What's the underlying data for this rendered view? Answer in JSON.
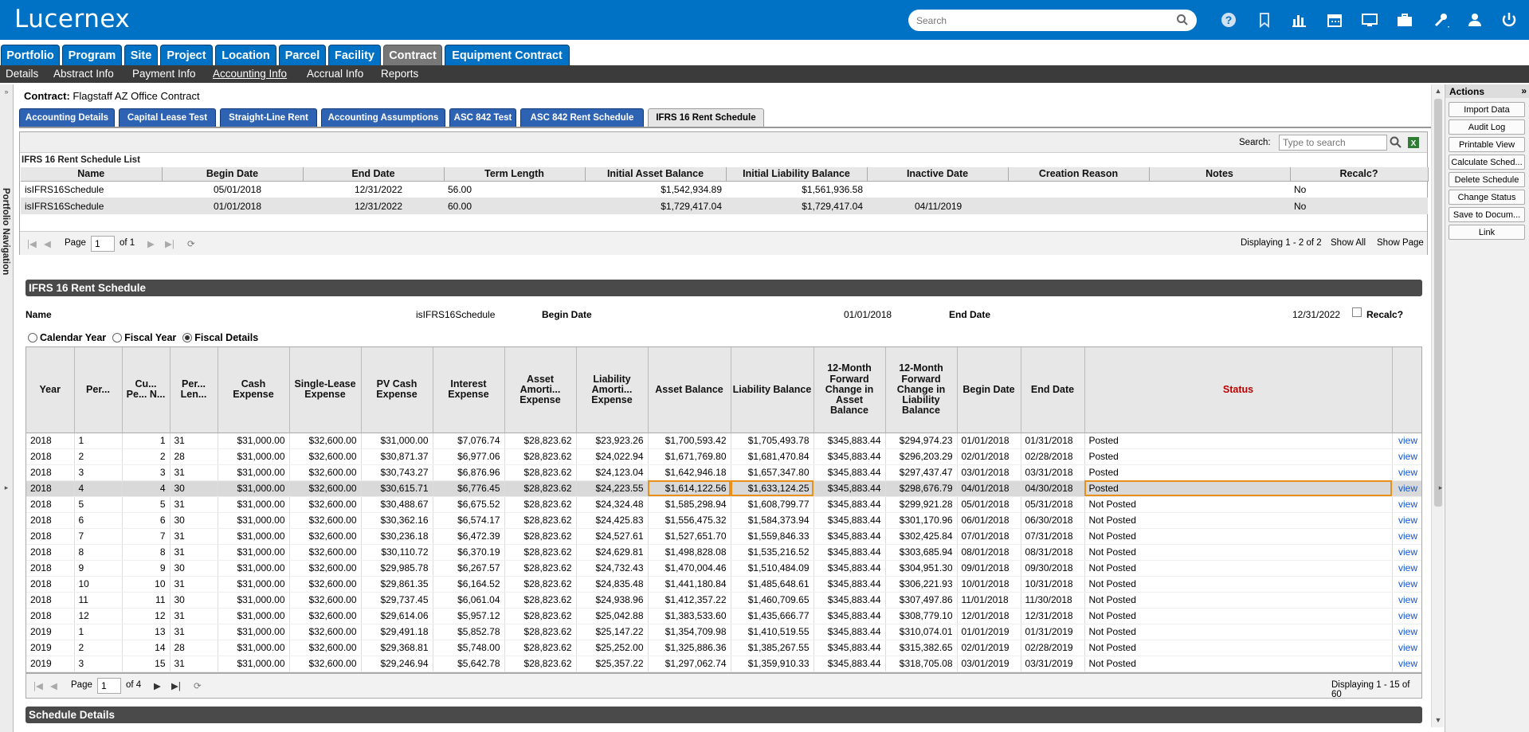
{
  "app": {
    "logo": "Lucernex"
  },
  "search": {
    "placeholder": "Search"
  },
  "nav_tabs": [
    "Portfolio",
    "Program",
    "Site",
    "Project",
    "Location",
    "Parcel",
    "Facility",
    "Contract",
    "Equipment Contract"
  ],
  "nav_active": "Contract",
  "sub_nav": [
    "Details",
    "Abstract Info",
    "Payment Info",
    "Accounting Info",
    "Accrual Info",
    "Reports"
  ],
  "sub_nav_active": "Accounting Info",
  "left_nav_label": "Portfolio Navigation",
  "contract": {
    "label": "Contract:",
    "name": "Flagstaff AZ Office Contract"
  },
  "content_tabs": [
    "Accounting Details",
    "Capital Lease Test",
    "Straight-Line Rent",
    "Accounting Assumptions",
    "ASC 842 Test",
    "ASC 842 Rent Schedule",
    "IFRS 16 Rent Schedule"
  ],
  "content_tab_active": "IFRS 16 Rent Schedule",
  "list": {
    "search_label": "Search:",
    "search_placeholder": "Type to search",
    "title": "IFRS 16 Rent Schedule List",
    "columns": [
      "Name",
      "Begin Date",
      "End Date",
      "Term Length",
      "Initial Asset Balance",
      "Initial Liability Balance",
      "Inactive Date",
      "Creation Reason",
      "Notes",
      "Recalc?"
    ],
    "rows": [
      [
        "isIFRS16Schedule",
        "05/01/2018",
        "12/31/2022",
        "56.00",
        "$1,542,934.89",
        "$1,561,936.58",
        "",
        "",
        "",
        "No"
      ],
      [
        "isIFRS16Schedule",
        "01/01/2018",
        "12/31/2022",
        "60.00",
        "$1,729,417.04",
        "$1,729,417.04",
        "04/11/2019",
        "",
        "",
        "No"
      ]
    ],
    "pager": {
      "page_label": "Page",
      "page": "1",
      "of": "of 1",
      "displaying": "Displaying 1 - 2 of 2",
      "show_all": "Show All",
      "show_page": "Show Page"
    }
  },
  "schedule": {
    "header": "IFRS 16 Rent Schedule",
    "name_label": "Name",
    "name_value": "isIFRS16Schedule",
    "begin_label": "Begin Date",
    "begin_value": "01/01/2018",
    "end_label": "End Date",
    "end_value": "12/31/2022",
    "recalc_label": "Recalc?",
    "view_options": [
      "Calendar Year",
      "Fiscal Year",
      "Fiscal Details"
    ],
    "view_selected": "Fiscal Details",
    "columns": [
      "Year",
      "Per...",
      "Cu... Pe... N...",
      "Per... Len...",
      "Cash Expense",
      "Single-Lease Expense",
      "PV Cash Expense",
      "Interest Expense",
      "Asset Amorti... Expense",
      "Liability Amorti... Expense",
      "Asset Balance",
      "Liability Balance",
      "12-Month Forward Change in Asset Balance",
      "12-Month Forward Change in Liability Balance",
      "Begin Date",
      "End Date",
      "Status",
      ""
    ],
    "view_link": "view",
    "rows": [
      [
        "2018",
        "1",
        "1",
        "31",
        "$31,000.00",
        "$32,600.00",
        "$31,000.00",
        "$7,076.74",
        "$28,823.62",
        "$23,923.26",
        "$1,700,593.42",
        "$1,705,493.78",
        "$345,883.44",
        "$294,974.23",
        "01/01/2018",
        "01/31/2018",
        "Posted"
      ],
      [
        "2018",
        "2",
        "2",
        "28",
        "$31,000.00",
        "$32,600.00",
        "$30,871.37",
        "$6,977.06",
        "$28,823.62",
        "$24,022.94",
        "$1,671,769.80",
        "$1,681,470.84",
        "$345,883.44",
        "$296,203.29",
        "02/01/2018",
        "02/28/2018",
        "Posted"
      ],
      [
        "2018",
        "3",
        "3",
        "31",
        "$31,000.00",
        "$32,600.00",
        "$30,743.27",
        "$6,876.96",
        "$28,823.62",
        "$24,123.04",
        "$1,642,946.18",
        "$1,657,347.80",
        "$345,883.44",
        "$297,437.47",
        "03/01/2018",
        "03/31/2018",
        "Posted"
      ],
      [
        "2018",
        "4",
        "4",
        "30",
        "$31,000.00",
        "$32,600.00",
        "$30,615.71",
        "$6,776.45",
        "$28,823.62",
        "$24,223.55",
        "$1,614,122.56",
        "$1,633,124.25",
        "$345,883.44",
        "$298,676.79",
        "04/01/2018",
        "04/30/2018",
        "Posted"
      ],
      [
        "2018",
        "5",
        "5",
        "31",
        "$31,000.00",
        "$32,600.00",
        "$30,488.67",
        "$6,675.52",
        "$28,823.62",
        "$24,324.48",
        "$1,585,298.94",
        "$1,608,799.77",
        "$345,883.44",
        "$299,921.28",
        "05/01/2018",
        "05/31/2018",
        "Not Posted"
      ],
      [
        "2018",
        "6",
        "6",
        "30",
        "$31,000.00",
        "$32,600.00",
        "$30,362.16",
        "$6,574.17",
        "$28,823.62",
        "$24,425.83",
        "$1,556,475.32",
        "$1,584,373.94",
        "$345,883.44",
        "$301,170.96",
        "06/01/2018",
        "06/30/2018",
        "Not Posted"
      ],
      [
        "2018",
        "7",
        "7",
        "31",
        "$31,000.00",
        "$32,600.00",
        "$30,236.18",
        "$6,472.39",
        "$28,823.62",
        "$24,527.61",
        "$1,527,651.70",
        "$1,559,846.33",
        "$345,883.44",
        "$302,425.84",
        "07/01/2018",
        "07/31/2018",
        "Not Posted"
      ],
      [
        "2018",
        "8",
        "8",
        "31",
        "$31,000.00",
        "$32,600.00",
        "$30,110.72",
        "$6,370.19",
        "$28,823.62",
        "$24,629.81",
        "$1,498,828.08",
        "$1,535,216.52",
        "$345,883.44",
        "$303,685.94",
        "08/01/2018",
        "08/31/2018",
        "Not Posted"
      ],
      [
        "2018",
        "9",
        "9",
        "30",
        "$31,000.00",
        "$32,600.00",
        "$29,985.78",
        "$6,267.57",
        "$28,823.62",
        "$24,732.43",
        "$1,470,004.46",
        "$1,510,484.09",
        "$345,883.44",
        "$304,951.30",
        "09/01/2018",
        "09/30/2018",
        "Not Posted"
      ],
      [
        "2018",
        "10",
        "10",
        "31",
        "$31,000.00",
        "$32,600.00",
        "$29,861.35",
        "$6,164.52",
        "$28,823.62",
        "$24,835.48",
        "$1,441,180.84",
        "$1,485,648.61",
        "$345,883.44",
        "$306,221.93",
        "10/01/2018",
        "10/31/2018",
        "Not Posted"
      ],
      [
        "2018",
        "11",
        "11",
        "30",
        "$31,000.00",
        "$32,600.00",
        "$29,737.45",
        "$6,061.04",
        "$28,823.62",
        "$24,938.96",
        "$1,412,357.22",
        "$1,460,709.65",
        "$345,883.44",
        "$307,497.86",
        "11/01/2018",
        "11/30/2018",
        "Not Posted"
      ],
      [
        "2018",
        "12",
        "12",
        "31",
        "$31,000.00",
        "$32,600.00",
        "$29,614.06",
        "$5,957.12",
        "$28,823.62",
        "$25,042.88",
        "$1,383,533.60",
        "$1,435,666.77",
        "$345,883.44",
        "$308,779.10",
        "12/01/2018",
        "12/31/2018",
        "Not Posted"
      ],
      [
        "2019",
        "1",
        "13",
        "31",
        "$31,000.00",
        "$32,600.00",
        "$29,491.18",
        "$5,852.78",
        "$28,823.62",
        "$25,147.22",
        "$1,354,709.98",
        "$1,410,519.55",
        "$345,883.44",
        "$310,074.01",
        "01/01/2019",
        "01/31/2019",
        "Not Posted"
      ],
      [
        "2019",
        "2",
        "14",
        "28",
        "$31,000.00",
        "$32,600.00",
        "$29,368.81",
        "$5,748.00",
        "$28,823.62",
        "$25,252.00",
        "$1,325,886.36",
        "$1,385,267.55",
        "$345,883.44",
        "$315,382.65",
        "02/01/2019",
        "02/28/2019",
        "Not Posted"
      ],
      [
        "2019",
        "3",
        "15",
        "31",
        "$31,000.00",
        "$32,600.00",
        "$29,246.94",
        "$5,642.78",
        "$28,823.62",
        "$25,357.22",
        "$1,297,062.74",
        "$1,359,910.33",
        "$345,883.44",
        "$318,705.08",
        "03/01/2019",
        "03/31/2019",
        "Not Posted"
      ]
    ],
    "pager": {
      "page_label": "Page",
      "page": "1",
      "of": "of 4",
      "displaying": "Displaying 1 - 15 of 60"
    }
  },
  "details_header": "Schedule Details",
  "actions": {
    "title": "Actions",
    "buttons": [
      "Import Data",
      "Audit Log",
      "Printable View",
      "Calculate Sched...",
      "Delete Schedule",
      "Change Status",
      "Save to Docum...",
      "Link"
    ]
  },
  "colors": {
    "brand": "#0072c6",
    "subnav": "#3b3b3b",
    "tab": "#2e63b4",
    "status_header": "#bb0000",
    "highlight": "#e8901a",
    "link": "#1155cc"
  }
}
